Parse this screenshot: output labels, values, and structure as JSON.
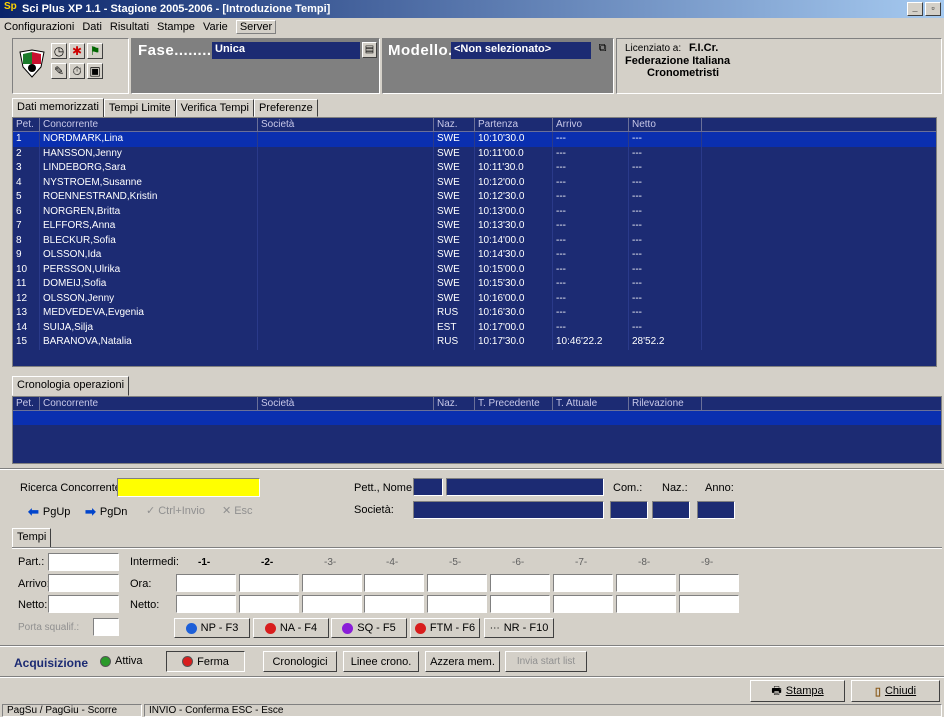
{
  "window": {
    "title": "Sci Plus XP 1.1 - Stagione 2005-2006 - [Introduzione Tempi]",
    "controls": [
      "_",
      "▫"
    ]
  },
  "menu": [
    "Configurazioni",
    "Dati",
    "Risultati",
    "Stampe",
    "Varie",
    "Server"
  ],
  "toolbar": {
    "fase_label": "Fase............:",
    "fase_value": "Unica",
    "modello_label": "Modello...",
    "modello_value": "<Non selezionato>",
    "licensee_label": "Licenziato a:",
    "licensee_short": "F.I.Cr.",
    "licensee_line2": "Federazione Italiana",
    "licensee_line3": "Cronometristi"
  },
  "tabs": [
    "Dati memorizzati",
    "Tempi Limite",
    "Verifica Tempi",
    "Preferenze"
  ],
  "grid": {
    "columns": [
      "Pet.",
      "Concorrente",
      "Società",
      "Naz.",
      "Partenza",
      "Arrivo",
      "Netto",
      ""
    ],
    "rows": [
      [
        "1",
        "NORDMARK,Lina",
        "",
        "SWE",
        "10:10'30.0",
        "---",
        "---"
      ],
      [
        "2",
        "HANSSON,Jenny",
        "",
        "SWE",
        "10:11'00.0",
        "---",
        "---"
      ],
      [
        "3",
        "LINDEBORG,Sara",
        "",
        "SWE",
        "10:11'30.0",
        "---",
        "---"
      ],
      [
        "4",
        "NYSTROEM,Susanne",
        "",
        "SWE",
        "10:12'00.0",
        "---",
        "---"
      ],
      [
        "5",
        "ROENNESTRAND,Kristin",
        "",
        "SWE",
        "10:12'30.0",
        "---",
        "---"
      ],
      [
        "6",
        "NORGREN,Britta",
        "",
        "SWE",
        "10:13'00.0",
        "---",
        "---"
      ],
      [
        "7",
        "ELFFORS,Anna",
        "",
        "SWE",
        "10:13'30.0",
        "---",
        "---"
      ],
      [
        "8",
        "BLECKUR,Sofia",
        "",
        "SWE",
        "10:14'00.0",
        "---",
        "---"
      ],
      [
        "9",
        "OLSSON,Ida",
        "",
        "SWE",
        "10:14'30.0",
        "---",
        "---"
      ],
      [
        "10",
        "PERSSON,Ulrika",
        "",
        "SWE",
        "10:15'00.0",
        "---",
        "---"
      ],
      [
        "11",
        "DOMEIJ,Sofia",
        "",
        "SWE",
        "10:15'30.0",
        "---",
        "---"
      ],
      [
        "12",
        "OLSSON,Jenny",
        "",
        "SWE",
        "10:16'00.0",
        "---",
        "---"
      ],
      [
        "13",
        "MEDVEDEVA,Evgenia",
        "",
        "RUS",
        "10:16'30.0",
        "---",
        "---"
      ],
      [
        "14",
        "SUIJA,Silja",
        "",
        "EST",
        "10:17'00.0",
        "---",
        "---"
      ],
      [
        "15",
        "BARANOVA,Natalia",
        "",
        "RUS",
        "10:17'30.0",
        "10:46'22.2",
        "28'52.2"
      ]
    ]
  },
  "cronologia": {
    "tab": "Cronologia operazioni",
    "columns": [
      "Pet.",
      "Concorrente",
      "Società",
      "Naz.",
      "T. Precedente",
      "T. Attuale",
      "Rilevazione",
      ""
    ]
  },
  "search": {
    "ricerca_label": "Ricerca Concorrente:",
    "pett_label": "Pett., Nome:",
    "societa_label": "Società:",
    "com_label": "Com.:",
    "naz_label": "Naz.:",
    "anno_label": "Anno:",
    "pgup": "PgUp",
    "pgdn": "PgDn",
    "ctrl_invio": "Ctrl+Invio",
    "esc": "Esc"
  },
  "tempi": {
    "tab": "Tempi",
    "part_label": "Part.:",
    "arrivo_label": "Arrivo:",
    "netto_label": "Netto:",
    "intermedi_label": "Intermedi:",
    "ora_label": "Ora:",
    "netto2_label": "Netto:",
    "porta_label": "Porta squalif.:",
    "intermedi": [
      "-1-",
      "-2-",
      "-3-",
      "-4-",
      "-5-",
      "-6-",
      "-7-",
      "-8-",
      "-9-"
    ],
    "buttons": [
      "NP - F3",
      "NA - F4",
      "SQ - F5",
      "FTM - F6",
      "NR - F10"
    ]
  },
  "acquisizione": {
    "label": "Acquisizione",
    "attiva": "Attiva",
    "ferma": "Ferma",
    "cronologici": "Cronologici",
    "linee": "Linee crono.",
    "azzera": "Azzera mem.",
    "invia": "Invia start list"
  },
  "footer": {
    "stampa": "Stampa",
    "chiudi": "Chiudi"
  },
  "status": [
    "PagSu / PagGiu - Scorre",
    "INVIO - Conferma   ESC - Esce"
  ],
  "colors": {
    "grid_bg": "#1c2b73",
    "selected_row": "#0a2fb0",
    "search_field": "#ffff00",
    "titlebar": "#0a246a"
  }
}
